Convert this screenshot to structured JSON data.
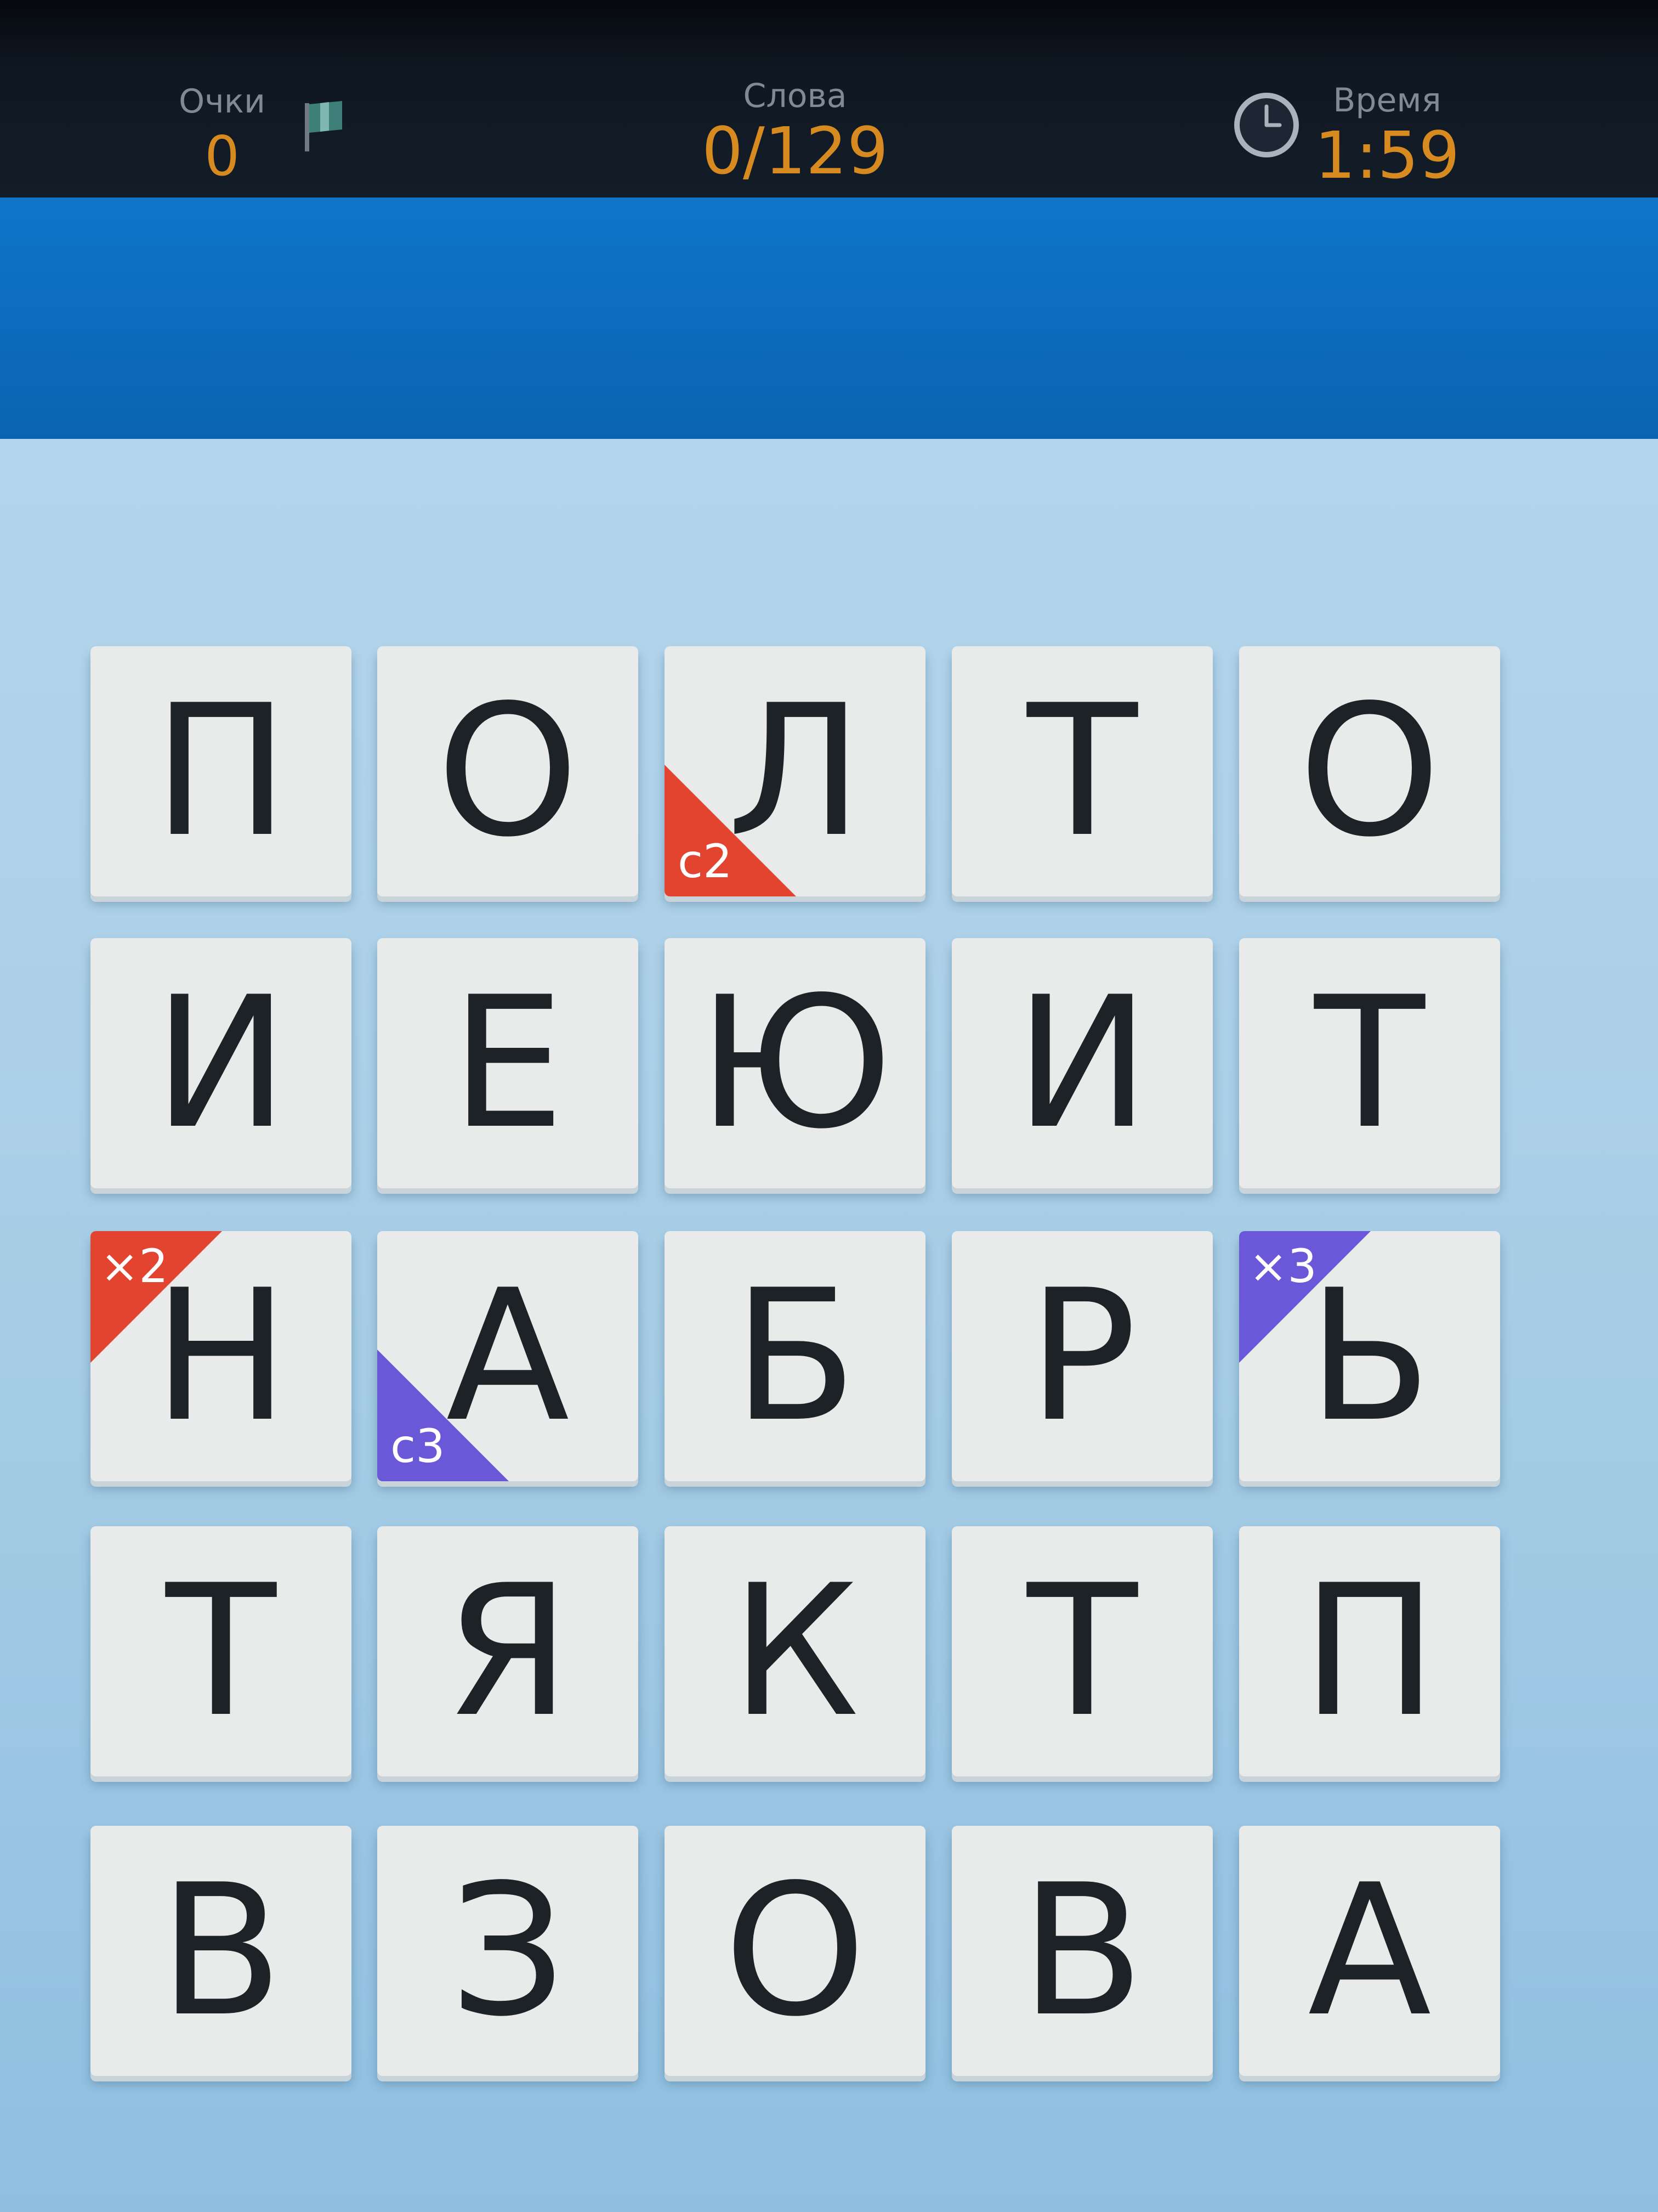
{
  "status_bar": {
    "score_label": "Очки",
    "score_value": "0",
    "words_label": "Слова",
    "words_value": "0/129",
    "time_label": "Время",
    "time_value": "1:59",
    "accent_color": "#d78a20"
  },
  "icons": {
    "flag": "flag-icon",
    "clock": "clock-icon"
  },
  "board": {
    "rows": [
      [
        "П",
        "О",
        "Л",
        "Т",
        "О"
      ],
      [
        "И",
        "Е",
        "Ю",
        "И",
        "Т"
      ],
      [
        "Н",
        "А",
        "Б",
        "Р",
        "Ь"
      ],
      [
        "Т",
        "Я",
        "К",
        "Т",
        "П"
      ],
      [
        "В",
        "З",
        "О",
        "В",
        "А"
      ]
    ],
    "bonuses": [
      {
        "row": 0,
        "col": 2,
        "label": "c2",
        "corner": "bottom-left",
        "color": "#e2442f"
      },
      {
        "row": 2,
        "col": 0,
        "label": "×2",
        "corner": "top-left",
        "color": "#e2442f"
      },
      {
        "row": 2,
        "col": 1,
        "label": "c3",
        "corner": "bottom-left",
        "color": "#6a58d8"
      },
      {
        "row": 2,
        "col": 4,
        "label": "×3",
        "corner": "top-left",
        "color": "#6a58d8"
      }
    ]
  }
}
